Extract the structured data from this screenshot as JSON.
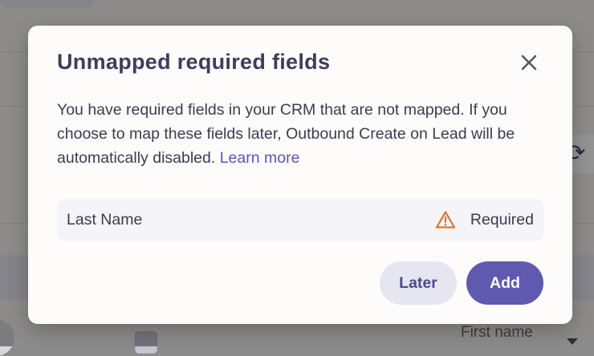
{
  "background": {
    "select_text": "First name",
    "refresh_glyph": "⟳"
  },
  "modal": {
    "title": "Unmapped required fields",
    "close_icon": "close-icon",
    "description": "You have required fields in your CRM that are not mapped. If you choose to map these fields later, Outbound Create on Lead will be automatically disabled.",
    "learn_more": "Learn more",
    "fields": [
      {
        "name": "Last Name",
        "status": "Required",
        "status_icon": "warning-icon",
        "status_color": "#d9772e"
      }
    ],
    "buttons": {
      "later": "Later",
      "add": "Add"
    },
    "colors": {
      "accent": "#5f59b0",
      "title": "#3e3d5c",
      "link": "#5b55b8"
    }
  }
}
